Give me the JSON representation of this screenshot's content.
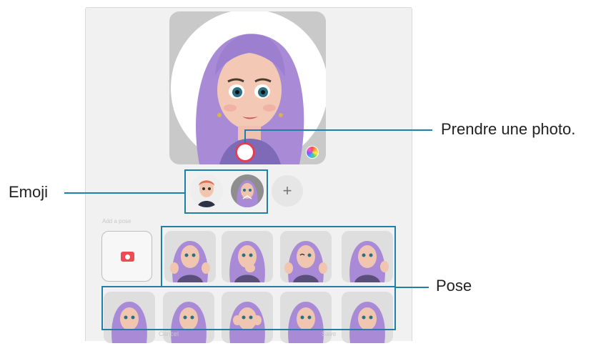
{
  "callouts": {
    "take_photo": "Prendre une photo.",
    "emoji": "Emoji",
    "pose": "Pose"
  },
  "camera": {
    "section_label": "Add a pose"
  },
  "bottom_bar": {
    "cancel_label": "Cancel",
    "save_label": "Save"
  },
  "colors": {
    "accent_callout": "#1f7fa6",
    "shutter_ring": "#e53e53",
    "avatar_hair": "#a98ad6"
  },
  "icons": {
    "shutter": "shutter-button-icon",
    "palette": "color-palette-icon",
    "add": "plus-icon",
    "camera": "camera-icon"
  },
  "add_symbol": "+"
}
